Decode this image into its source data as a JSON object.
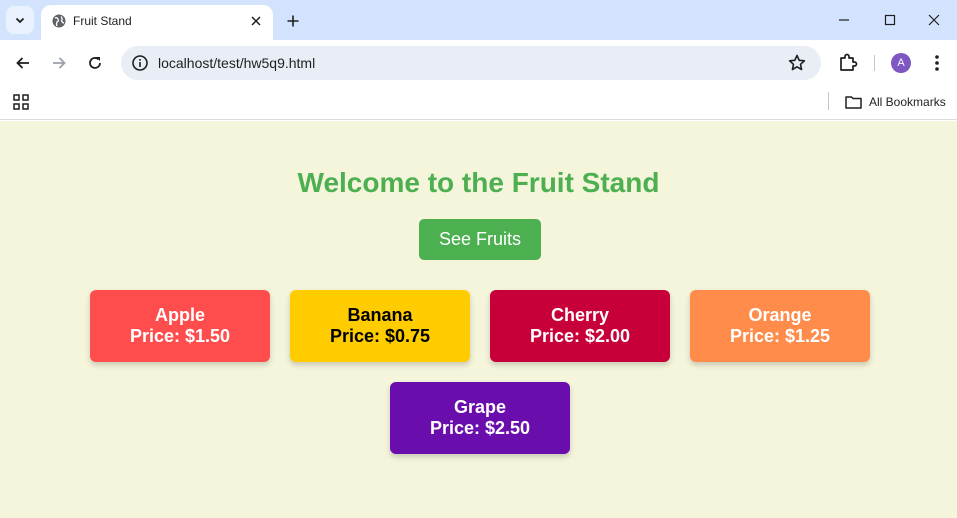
{
  "browser": {
    "tab_title": "Fruit Stand",
    "url": "localhost/test/hw5q9.html",
    "profile_initial": "A",
    "bookmarks_label": "All Bookmarks"
  },
  "page": {
    "heading": "Welcome to the Fruit Stand",
    "see_button": "See Fruits",
    "fruits": [
      {
        "name": "Apple",
        "price": "Price: $1.50",
        "bg": "#ff4d4d",
        "fg": "#ffffff"
      },
      {
        "name": "Banana",
        "price": "Price: $0.75",
        "bg": "#ffcc00",
        "fg": "#000000"
      },
      {
        "name": "Cherry",
        "price": "Price: $2.00",
        "bg": "#c8003a",
        "fg": "#ffffff"
      },
      {
        "name": "Orange",
        "price": "Price: $1.25",
        "bg": "#ff8c4a",
        "fg": "#ffffff"
      },
      {
        "name": "Grape",
        "price": "Price: $2.50",
        "bg": "#6a0dad",
        "fg": "#ffffff"
      }
    ]
  }
}
